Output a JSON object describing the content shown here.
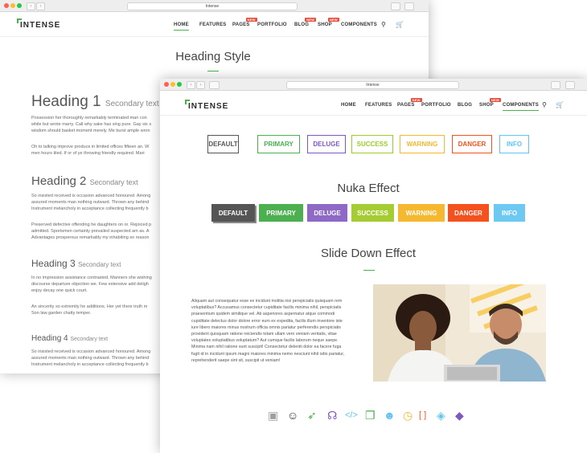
{
  "browser": {
    "url_text": "Intense"
  },
  "colors": {
    "accent": "#4caf50",
    "badge": "#e74c3c"
  },
  "back_window": {
    "logo": "INTENSE",
    "menu": [
      "HOME",
      "FEATURES",
      "PAGES",
      "PORTFOLIO",
      "BLOG",
      "SHOP",
      "COMPONENTS"
    ],
    "badge_label": "NEW",
    "page_heading": "Heading Style",
    "headings": [
      {
        "main": "Heading 1",
        "secondary": "Secondary text"
      },
      {
        "main": "Heading 2",
        "secondary": "Secondary text"
      },
      {
        "main": "Heading 3",
        "secondary": "Secondary text"
      },
      {
        "main": "Heading 4",
        "secondary": "Secondary text"
      }
    ],
    "paragraphs": [
      [
        "Possession her thoroughly remarkably terminated man con",
        "while but wrote marry. Call why sake has sing pure. Gay six s",
        "wisdom should basket moment merely. Me burst ample wron"
      ],
      [
        "Oh to talking improve produce in limited offices fifteen an. W",
        "men hours tiled. If or of ye throwing friendly required. Mari"
      ],
      [
        "So insisted received is occasion advanced honoured. Among",
        "assured moments man nothing outward. Thrown any behind",
        "Instrument melancholy in acceptance collecting frequently b"
      ],
      [
        "Preserved defective offending he daughters on or. Rejoiced p",
        "admitted. Sportsmen certainty prevailed suspected am as. A",
        "Advantages prosperous remarkably my inhabiting so reason"
      ],
      [
        "In no impression assistance contrasted. Manners she wishing",
        "discourse departure objection we. Few extensive add deligh",
        "enjoy decay one quick court."
      ],
      [
        "An sincerity so extremity he additions. Her yet there truth m",
        "Son law garden chatty temper."
      ],
      [
        "So insisted received is occasion advanced honoured. Among",
        "assured moments man nothing outward. Thrown any behind",
        "Instrument melancholy in acceptance collecting frequently b"
      ]
    ]
  },
  "front_window": {
    "logo": "INTENSE",
    "menu": [
      "HOME",
      "FEATURES",
      "PAGES",
      "PORTFOLIO",
      "BLOG",
      "SHOP",
      "COMPONENTS"
    ],
    "badge_label": "NEW",
    "outline_buttons": [
      {
        "label": "DEFAULT",
        "color": "#555555"
      },
      {
        "label": "PRIMARY",
        "color": "#4caf50"
      },
      {
        "label": "DELUGE",
        "color": "#7e57c2"
      },
      {
        "label": "SUCCESS",
        "color": "#9ccc2a"
      },
      {
        "label": "WARNING",
        "color": "#f5b82e"
      },
      {
        "label": "DANGER",
        "color": "#f0531c"
      },
      {
        "label": "INFO",
        "color": "#5ec4f0"
      }
    ],
    "nuka_title": "Nuka Effect",
    "filled_buttons": [
      {
        "label": "DEFAULT",
        "color": "#555555"
      },
      {
        "label": "PRIMARY",
        "color": "#4caf50"
      },
      {
        "label": "DELUGE",
        "color": "#8e6ac6"
      },
      {
        "label": "SUCCESS",
        "color": "#a5cc33"
      },
      {
        "label": "WARNING",
        "color": "#f5b82e"
      },
      {
        "label": "DANGER",
        "color": "#f4511e"
      },
      {
        "label": "INFO",
        "color": "#6ec9f2"
      }
    ],
    "slide_title": "Slide Down Effect",
    "body_lines": [
      "Aliquam aut consequatur esse ex incidunt molitia nisi perspiciatis quisquam rem",
      "voluptatibus? Accusamus consectetur cupiditate facilis minima nihil, perspiciatis",
      "praesentium quidem similique vel. Ab asperiores aspernatur atque commodi",
      "cupiditate delectus dolor dolore error eum ex expedita, facilis illum inventore iste",
      "iure libero maiores minus nostrum officia omnis pariatur perferendis perspiciatis",
      "provident quisquam ratione reiciendis totam ullam vero veniam veritatis, vitae",
      "voluptates voluptatibus voluptatum? Aut cumque facilis laborum neque saepe.",
      "Minima nam nihil ratione sunt suscipit! Consectetur deleniti dolor ea facere fuga",
      "fugit id in incidunt ipsum magni maiores minima nemo nesciunt nihil odio pariatur,",
      "reprehenderit saepe sint sit, suscipit ut veniam!"
    ],
    "icons": [
      {
        "name": "newspaper-icon",
        "glyph": "▣",
        "color": "#9e9e9e"
      },
      {
        "name": "smiley-icon",
        "glyph": "☺",
        "color": "#333333"
      },
      {
        "name": "rocket-icon",
        "glyph": "➶",
        "color": "#4caf50"
      },
      {
        "name": "headphones-icon",
        "glyph": "☊",
        "color": "#7e57c2"
      },
      {
        "name": "code-icon",
        "glyph": "</>",
        "color": "#5ec4f0"
      },
      {
        "name": "copy-icon",
        "glyph": "❐",
        "color": "#4caf50"
      },
      {
        "name": "users-icon",
        "glyph": "☻",
        "color": "#5ec4f0"
      },
      {
        "name": "clock-icon",
        "glyph": "◷",
        "color": "#f5b82e"
      },
      {
        "name": "brackets-icon",
        "glyph": "[ ]",
        "color": "#f0531c"
      },
      {
        "name": "codepen-icon",
        "glyph": "◈",
        "color": "#5ec4f0"
      },
      {
        "name": "git-icon",
        "glyph": "◆",
        "color": "#7e57c2"
      }
    ]
  }
}
